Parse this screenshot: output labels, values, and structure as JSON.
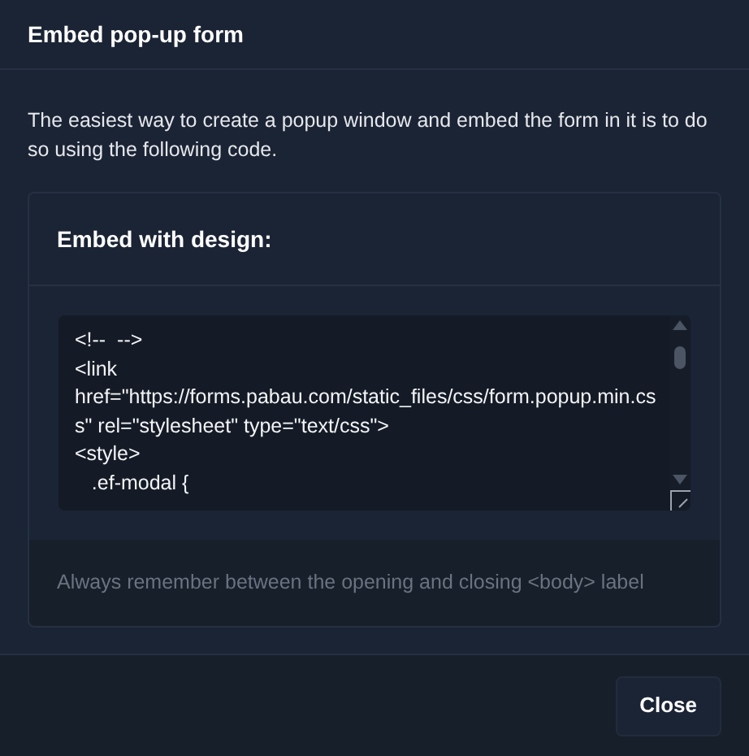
{
  "dialog": {
    "title": "Embed pop-up form"
  },
  "description": "The easiest way to create a popup window and embed the form in it is to do so using the following code.",
  "card": {
    "title": "Embed with design:",
    "code_lines": [
      "<!--  -->",
      "<link",
      "href=\"https://forms.pabau.com/static_files/css/form.popup.min.css\" rel=\"stylesheet\" type=\"text/css\">",
      "<style>",
      "   .ef-modal {"
    ],
    "hint": "Always remember between the opening and closing <body> label"
  },
  "buttons": [
    {
      "label": "Close"
    }
  ]
}
